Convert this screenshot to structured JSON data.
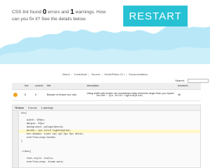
{
  "hero": {
    "text_prefix": "CSS lint found",
    "errors_count": "0",
    "text_middle": "errors and",
    "warnings_count": "1",
    "text_suffix": "warnings. How can you fix it? See the details below.",
    "restart_label": "RESTART",
    "accent_color": "#27c1d4"
  },
  "nav": {
    "links": [
      "About",
      "Contribute",
      "Source",
      "Node/Rhino CLI",
      "Documentation"
    ]
  },
  "search": {
    "label": "Search:",
    "value": ""
  },
  "results_table": {
    "headers": [
      "",
      "line",
      "column",
      "title",
      "description",
      "browsers"
    ],
    "rows": [
      {
        "icon": "warning-icon",
        "line": "8",
        "column": "5",
        "title": "Beware of broken box size.",
        "description": "Using width with border can sometimes make elements larger than you expect.",
        "code": "border: 1px solid lightskyblue;",
        "browsers": "All"
      }
    ]
  },
  "code_panel": {
    "tabs": [
      {
        "label": "78 lines",
        "active": true
      },
      {
        "label": "0 errors",
        "active": false
      },
      {
        "label": "1 warnings",
        "active": false
      }
    ],
    "lines": [
      "div{",
      "",
      "    width: 100px;",
      "    margin: 25px;",
      "    background: palegoldenrod;",
      "    border: 1px solid lightskyblue;",
      "    box-shadow: inset 1px 1px 5px 5px white;",
      "    overflow-wrap:normal;",
      "}",
      "",
      "",
      ".class{",
      "",
      "    font-style: italic;",
      "    overflow-wrap: break-word;"
    ],
    "highlighted_line_index": 5
  }
}
